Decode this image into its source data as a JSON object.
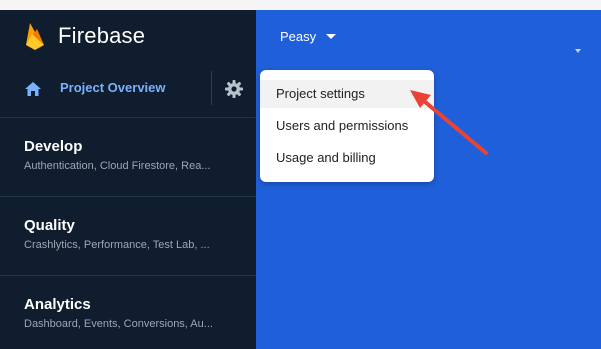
{
  "brand": {
    "name": "Firebase",
    "icon": "firebase-flame-icon"
  },
  "nav": {
    "overview_label": "Project Overview",
    "home_icon": "home-icon",
    "settings_icon": "gear-icon"
  },
  "sections": [
    {
      "title": "Develop",
      "subtitle": "Authentication, Cloud Firestore, Rea..."
    },
    {
      "title": "Quality",
      "subtitle": "Crashlytics, Performance, Test Lab, ..."
    },
    {
      "title": "Analytics",
      "subtitle": "Dashboard, Events, Conversions, Au..."
    }
  ],
  "project": {
    "name": "Peasy"
  },
  "menu": {
    "items": [
      {
        "label": "Project settings"
      },
      {
        "label": "Users and permissions"
      },
      {
        "label": "Usage and billing"
      }
    ]
  },
  "colors": {
    "sidebar_bg": "#0f1d2e",
    "main_bg": "#1f5fd9",
    "accent_text": "#7bb0ff",
    "firebase_yellow": "#ffca28",
    "firebase_orange": "#ffa000",
    "annotation_arrow": "#ea4335"
  }
}
